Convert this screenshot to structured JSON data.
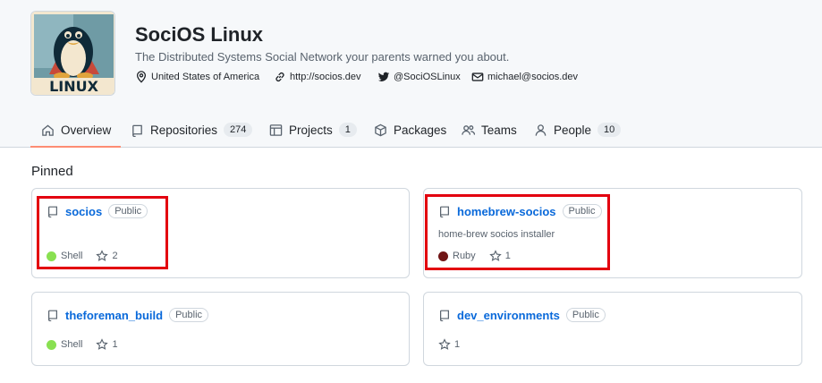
{
  "org": {
    "name": "SociOS Linux",
    "description": "The Distributed Systems Social Network your parents warned you about.",
    "avatar_text": "LINUX",
    "location": "United States of America",
    "website": "http://socios.dev",
    "twitter": "@SociOSLinux",
    "email": "michael@socios.dev"
  },
  "tabs": [
    {
      "label": "Overview",
      "icon": "home-icon",
      "active": true
    },
    {
      "label": "Repositories",
      "icon": "repo-icon",
      "count": "274"
    },
    {
      "label": "Projects",
      "icon": "table-icon",
      "count": "1"
    },
    {
      "label": "Packages",
      "icon": "package-icon"
    },
    {
      "label": "Teams",
      "icon": "people-icon"
    },
    {
      "label": "People",
      "icon": "person-icon",
      "count": "10"
    }
  ],
  "pinned": {
    "title": "Pinned",
    "repos": [
      {
        "name": "socios",
        "visibility": "Public",
        "description": "",
        "language": "Shell",
        "language_color": "#89e051",
        "stars": "2",
        "highlighted": true
      },
      {
        "name": "homebrew-socios",
        "visibility": "Public",
        "description": "home-brew socios installer",
        "language": "Ruby",
        "language_color": "#701516",
        "stars": "1",
        "highlighted": true
      },
      {
        "name": "theforeman_build",
        "visibility": "Public",
        "description": "",
        "language": "Shell",
        "language_color": "#89e051",
        "stars": "1",
        "highlighted": false
      },
      {
        "name": "dev_environments",
        "visibility": "Public",
        "description": "",
        "language": "",
        "stars": "1",
        "highlighted": false
      }
    ]
  },
  "colors": {
    "accent": "#0969da",
    "tab_underline": "#fd8c73",
    "highlight": "#e3000f"
  }
}
